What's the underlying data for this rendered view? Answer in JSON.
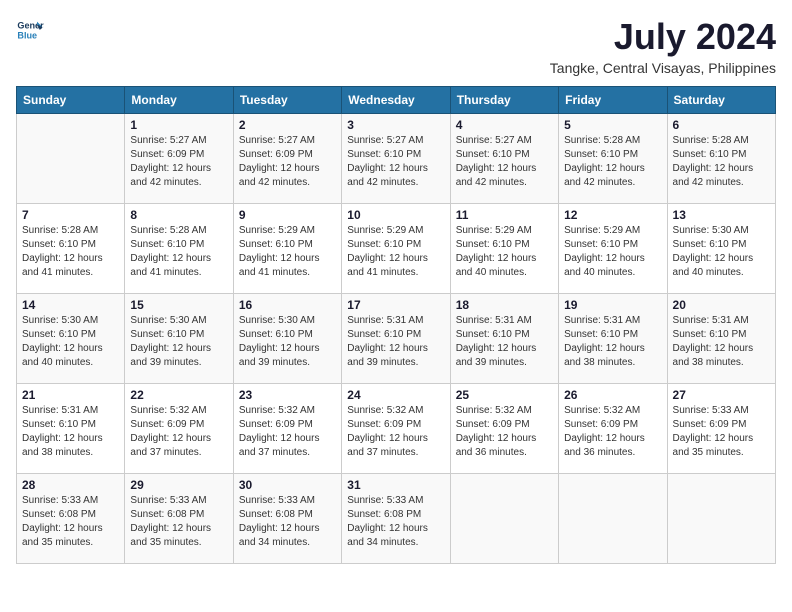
{
  "header": {
    "logo_line1": "General",
    "logo_line2": "Blue",
    "title": "July 2024",
    "subtitle": "Tangke, Central Visayas, Philippines"
  },
  "weekdays": [
    "Sunday",
    "Monday",
    "Tuesday",
    "Wednesday",
    "Thursday",
    "Friday",
    "Saturday"
  ],
  "weeks": [
    [
      {
        "day": "",
        "sunrise": "",
        "sunset": "",
        "daylight": ""
      },
      {
        "day": "1",
        "sunrise": "Sunrise: 5:27 AM",
        "sunset": "Sunset: 6:09 PM",
        "daylight": "Daylight: 12 hours and 42 minutes."
      },
      {
        "day": "2",
        "sunrise": "Sunrise: 5:27 AM",
        "sunset": "Sunset: 6:09 PM",
        "daylight": "Daylight: 12 hours and 42 minutes."
      },
      {
        "day": "3",
        "sunrise": "Sunrise: 5:27 AM",
        "sunset": "Sunset: 6:10 PM",
        "daylight": "Daylight: 12 hours and 42 minutes."
      },
      {
        "day": "4",
        "sunrise": "Sunrise: 5:27 AM",
        "sunset": "Sunset: 6:10 PM",
        "daylight": "Daylight: 12 hours and 42 minutes."
      },
      {
        "day": "5",
        "sunrise": "Sunrise: 5:28 AM",
        "sunset": "Sunset: 6:10 PM",
        "daylight": "Daylight: 12 hours and 42 minutes."
      },
      {
        "day": "6",
        "sunrise": "Sunrise: 5:28 AM",
        "sunset": "Sunset: 6:10 PM",
        "daylight": "Daylight: 12 hours and 42 minutes."
      }
    ],
    [
      {
        "day": "7",
        "sunrise": "Sunrise: 5:28 AM",
        "sunset": "Sunset: 6:10 PM",
        "daylight": "Daylight: 12 hours and 41 minutes."
      },
      {
        "day": "8",
        "sunrise": "Sunrise: 5:28 AM",
        "sunset": "Sunset: 6:10 PM",
        "daylight": "Daylight: 12 hours and 41 minutes."
      },
      {
        "day": "9",
        "sunrise": "Sunrise: 5:29 AM",
        "sunset": "Sunset: 6:10 PM",
        "daylight": "Daylight: 12 hours and 41 minutes."
      },
      {
        "day": "10",
        "sunrise": "Sunrise: 5:29 AM",
        "sunset": "Sunset: 6:10 PM",
        "daylight": "Daylight: 12 hours and 41 minutes."
      },
      {
        "day": "11",
        "sunrise": "Sunrise: 5:29 AM",
        "sunset": "Sunset: 6:10 PM",
        "daylight": "Daylight: 12 hours and 40 minutes."
      },
      {
        "day": "12",
        "sunrise": "Sunrise: 5:29 AM",
        "sunset": "Sunset: 6:10 PM",
        "daylight": "Daylight: 12 hours and 40 minutes."
      },
      {
        "day": "13",
        "sunrise": "Sunrise: 5:30 AM",
        "sunset": "Sunset: 6:10 PM",
        "daylight": "Daylight: 12 hours and 40 minutes."
      }
    ],
    [
      {
        "day": "14",
        "sunrise": "Sunrise: 5:30 AM",
        "sunset": "Sunset: 6:10 PM",
        "daylight": "Daylight: 12 hours and 40 minutes."
      },
      {
        "day": "15",
        "sunrise": "Sunrise: 5:30 AM",
        "sunset": "Sunset: 6:10 PM",
        "daylight": "Daylight: 12 hours and 39 minutes."
      },
      {
        "day": "16",
        "sunrise": "Sunrise: 5:30 AM",
        "sunset": "Sunset: 6:10 PM",
        "daylight": "Daylight: 12 hours and 39 minutes."
      },
      {
        "day": "17",
        "sunrise": "Sunrise: 5:31 AM",
        "sunset": "Sunset: 6:10 PM",
        "daylight": "Daylight: 12 hours and 39 minutes."
      },
      {
        "day": "18",
        "sunrise": "Sunrise: 5:31 AM",
        "sunset": "Sunset: 6:10 PM",
        "daylight": "Daylight: 12 hours and 39 minutes."
      },
      {
        "day": "19",
        "sunrise": "Sunrise: 5:31 AM",
        "sunset": "Sunset: 6:10 PM",
        "daylight": "Daylight: 12 hours and 38 minutes."
      },
      {
        "day": "20",
        "sunrise": "Sunrise: 5:31 AM",
        "sunset": "Sunset: 6:10 PM",
        "daylight": "Daylight: 12 hours and 38 minutes."
      }
    ],
    [
      {
        "day": "21",
        "sunrise": "Sunrise: 5:31 AM",
        "sunset": "Sunset: 6:10 PM",
        "daylight": "Daylight: 12 hours and 38 minutes."
      },
      {
        "day": "22",
        "sunrise": "Sunrise: 5:32 AM",
        "sunset": "Sunset: 6:09 PM",
        "daylight": "Daylight: 12 hours and 37 minutes."
      },
      {
        "day": "23",
        "sunrise": "Sunrise: 5:32 AM",
        "sunset": "Sunset: 6:09 PM",
        "daylight": "Daylight: 12 hours and 37 minutes."
      },
      {
        "day": "24",
        "sunrise": "Sunrise: 5:32 AM",
        "sunset": "Sunset: 6:09 PM",
        "daylight": "Daylight: 12 hours and 37 minutes."
      },
      {
        "day": "25",
        "sunrise": "Sunrise: 5:32 AM",
        "sunset": "Sunset: 6:09 PM",
        "daylight": "Daylight: 12 hours and 36 minutes."
      },
      {
        "day": "26",
        "sunrise": "Sunrise: 5:32 AM",
        "sunset": "Sunset: 6:09 PM",
        "daylight": "Daylight: 12 hours and 36 minutes."
      },
      {
        "day": "27",
        "sunrise": "Sunrise: 5:33 AM",
        "sunset": "Sunset: 6:09 PM",
        "daylight": "Daylight: 12 hours and 35 minutes."
      }
    ],
    [
      {
        "day": "28",
        "sunrise": "Sunrise: 5:33 AM",
        "sunset": "Sunset: 6:08 PM",
        "daylight": "Daylight: 12 hours and 35 minutes."
      },
      {
        "day": "29",
        "sunrise": "Sunrise: 5:33 AM",
        "sunset": "Sunset: 6:08 PM",
        "daylight": "Daylight: 12 hours and 35 minutes."
      },
      {
        "day": "30",
        "sunrise": "Sunrise: 5:33 AM",
        "sunset": "Sunset: 6:08 PM",
        "daylight": "Daylight: 12 hours and 34 minutes."
      },
      {
        "day": "31",
        "sunrise": "Sunrise: 5:33 AM",
        "sunset": "Sunset: 6:08 PM",
        "daylight": "Daylight: 12 hours and 34 minutes."
      },
      {
        "day": "",
        "sunrise": "",
        "sunset": "",
        "daylight": ""
      },
      {
        "day": "",
        "sunrise": "",
        "sunset": "",
        "daylight": ""
      },
      {
        "day": "",
        "sunrise": "",
        "sunset": "",
        "daylight": ""
      }
    ]
  ]
}
